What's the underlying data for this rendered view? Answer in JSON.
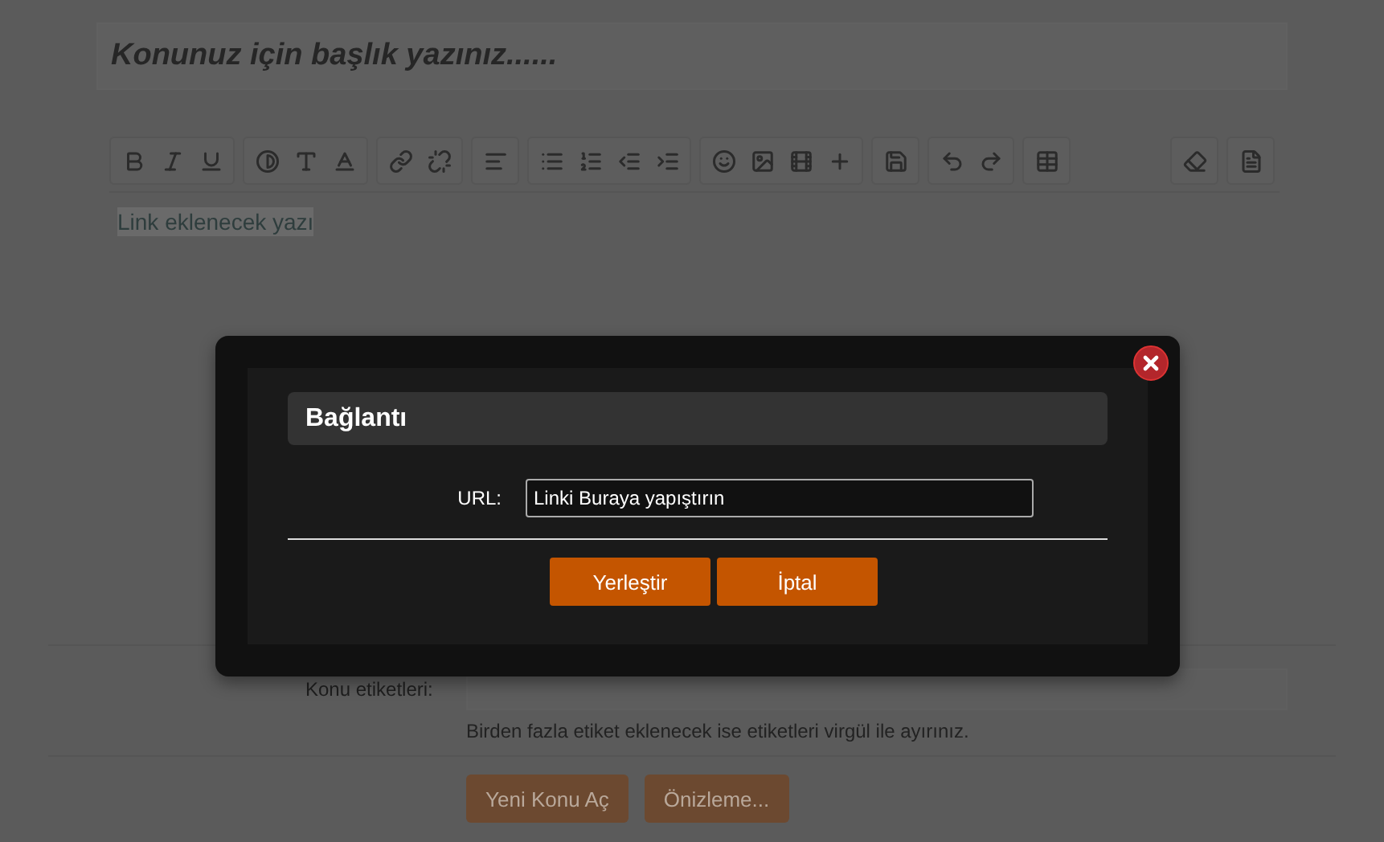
{
  "title_field": {
    "placeholder": "Konunuz için başlık yazınız......"
  },
  "editor": {
    "text": "Link eklenecek yazı",
    "selected": true
  },
  "tags": {
    "label": "Konu etiketleri:",
    "hint": "Birden fazla etiket eklenecek ise etiketleri virgül ile ayırınız."
  },
  "actions": [
    "Yeni Konu Aç",
    "Önizleme..."
  ],
  "dialog": {
    "title": "Bağlantı",
    "url_label": "URL:",
    "url_value": "Linki Buraya yapıştırın",
    "buttons": [
      "Yerleştir",
      "İptal"
    ]
  }
}
